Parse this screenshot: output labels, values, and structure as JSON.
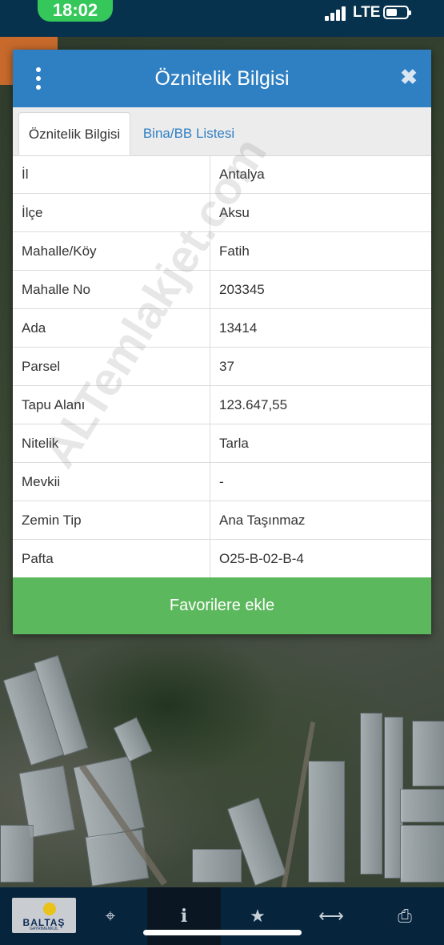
{
  "status_bar": {
    "time": "18:02",
    "network": "LTE",
    "battery_fraction": 0.4,
    "signal_bars": 4
  },
  "dialog": {
    "title": "Öznitelik Bilgisi",
    "menu_icon": "kebab-menu-icon",
    "close_icon": "close-icon",
    "tabs": [
      {
        "label": "Öznitelik Bilgisi",
        "active": true
      },
      {
        "label": "Bina/BB Listesi",
        "active": false
      }
    ],
    "rows": [
      {
        "key": "İl",
        "value": "Antalya"
      },
      {
        "key": "İlçe",
        "value": "Aksu"
      },
      {
        "key": "Mahalle/Köy",
        "value": "Fatih"
      },
      {
        "key": "Mahalle No",
        "value": "203345"
      },
      {
        "key": "Ada",
        "value": "13414"
      },
      {
        "key": "Parsel",
        "value": "37"
      },
      {
        "key": "Tapu Alanı",
        "value": "123.647,55"
      },
      {
        "key": "Nitelik",
        "value": "Tarla"
      },
      {
        "key": "Mevkii",
        "value": "-"
      },
      {
        "key": "Zemin Tip",
        "value": "Ana Taşınmaz"
      },
      {
        "key": "Pafta",
        "value": "O25-B-02-B-4"
      }
    ],
    "favorite_button": "Favorilere ekle"
  },
  "watermark": "ALTemlakjet.com",
  "toolbar": {
    "logo_text": "BALTAŞ",
    "logo_subtext": "GAYRİMENKUL",
    "buttons": [
      {
        "icon": "crosshair-icon",
        "glyph": "⌖"
      },
      {
        "icon": "info-icon",
        "glyph": "i",
        "active": true
      },
      {
        "icon": "star-icon",
        "glyph": "★"
      },
      {
        "icon": "measure-icon",
        "glyph": "⟷"
      },
      {
        "icon": "print-icon",
        "glyph": "⎙"
      }
    ]
  },
  "colors": {
    "header": "#2f7fc3",
    "accent_button": "#5cb85c",
    "toolbar": "#06243c",
    "time_pill": "#35c759"
  }
}
